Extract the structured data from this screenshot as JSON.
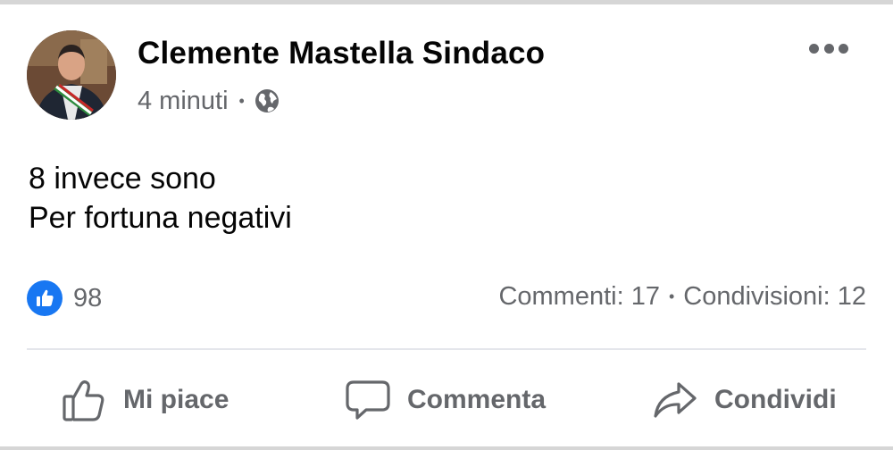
{
  "post": {
    "author": "Clemente Mastella Sindaco",
    "timestamp": "4 minuti",
    "meta_separator": "•",
    "privacy_icon": "globe-icon",
    "text_lines": [
      "8 invece sono",
      "Per fortuna negativi"
    ]
  },
  "stats": {
    "reaction_icon": "like-icon",
    "reaction_count": "98",
    "comments": "Commenti: 17",
    "separator": "•",
    "shares": "Condivisioni: 12"
  },
  "actions": {
    "like_label": "Mi piace",
    "comment_label": "Commenta",
    "share_label": "Condividi"
  },
  "colors": {
    "accent": "#1877f2",
    "secondary_text": "#65676b",
    "primary_text": "#050505"
  }
}
